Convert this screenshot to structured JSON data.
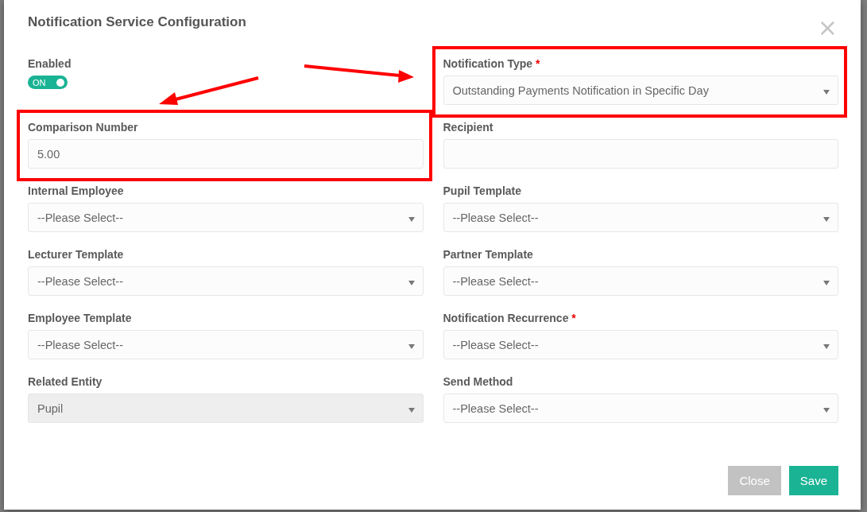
{
  "dialog": {
    "title": "Notification Service Configuration",
    "close_icon": "×"
  },
  "fields": [
    {
      "kind": "toggle",
      "label": "Enabled",
      "on": true,
      "value": "ON",
      "highlighted": false
    },
    {
      "kind": "select",
      "label": "Notification Type",
      "required_mark": "*",
      "value": "Outstanding Payments Notification in Specific Day",
      "disabled": false,
      "highlighted": true
    },
    {
      "kind": "input",
      "label": "Comparison Number",
      "value": "5.00",
      "highlighted": true
    },
    {
      "kind": "input",
      "label": "Recipient",
      "highlighted": false
    },
    {
      "kind": "select",
      "label": "Internal Employee",
      "value": "--Please Select--",
      "disabled": false,
      "highlighted": false
    },
    {
      "kind": "select",
      "label": "Pupil Template",
      "value": "--Please Select--",
      "disabled": false,
      "highlighted": false
    },
    {
      "kind": "select",
      "label": "Lecturer Template",
      "value": "--Please Select--",
      "disabled": false,
      "highlighted": false
    },
    {
      "kind": "select",
      "label": "Partner Template",
      "value": "--Please Select--",
      "disabled": false,
      "highlighted": false
    },
    {
      "kind": "select",
      "label": "Employee Template",
      "value": "--Please Select--",
      "disabled": false,
      "highlighted": false
    },
    {
      "kind": "select",
      "label": "Notification Recurrence",
      "required_mark": "*",
      "value": "--Please Select--",
      "disabled": false,
      "highlighted": false
    },
    {
      "kind": "select",
      "label": "Related Entity",
      "value": "Pupil",
      "disabled": true,
      "highlighted": false
    },
    {
      "kind": "select",
      "label": "Send Method",
      "value": "--Please Select--",
      "disabled": false,
      "highlighted": false
    }
  ],
  "buttons": [
    {
      "kind": "secondary",
      "label": "Close"
    },
    {
      "kind": "primary",
      "label": "Save"
    }
  ]
}
